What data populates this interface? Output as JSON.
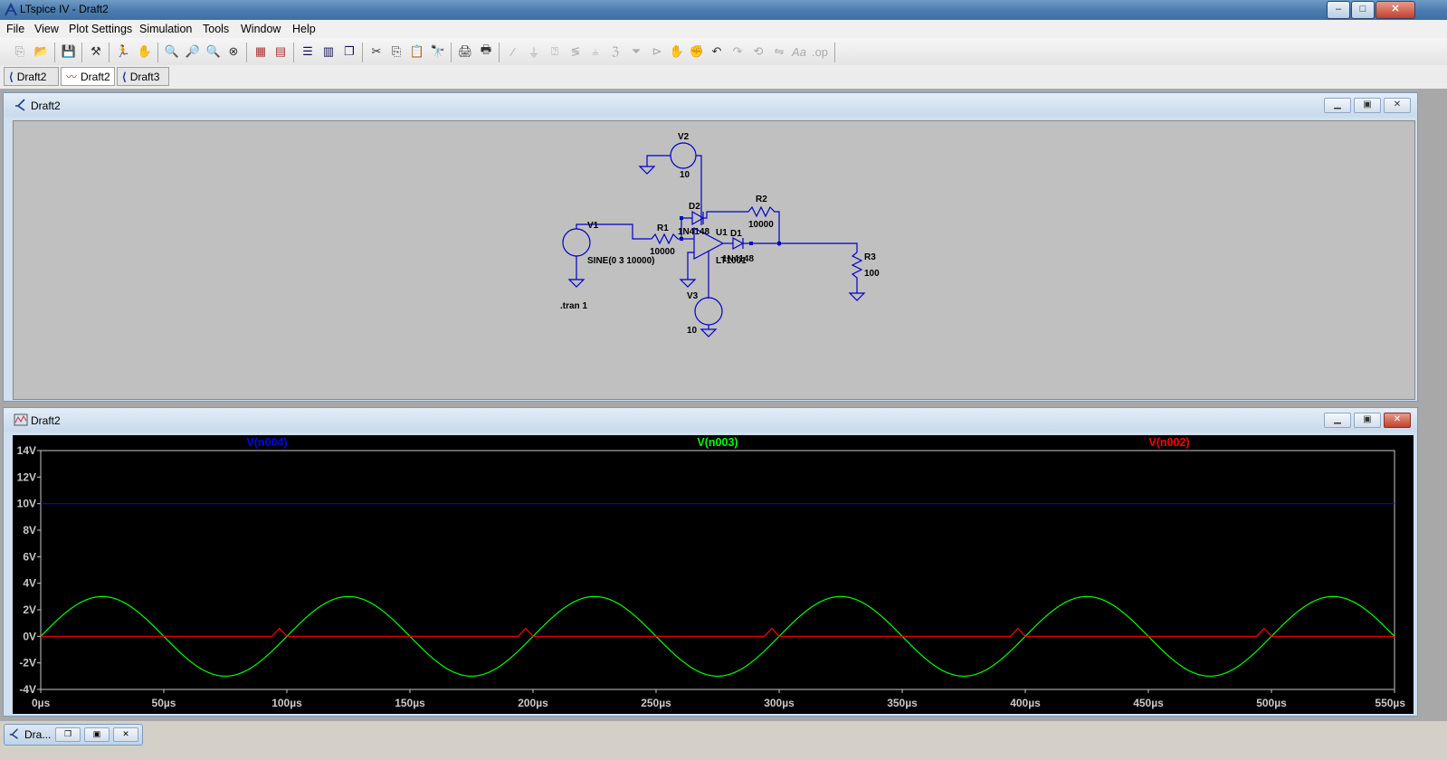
{
  "window": {
    "title": "LTspice IV - Draft2",
    "controls": [
      "–",
      "□",
      "✕"
    ]
  },
  "menu": [
    "File",
    "View",
    "Plot Settings",
    "Simulation",
    "Tools",
    "Window",
    "Help"
  ],
  "tabs": [
    {
      "label": "Draft2",
      "icon": "schematic-icon"
    },
    {
      "label": "Draft2",
      "icon": "waveform-icon"
    },
    {
      "label": "Draft3",
      "icon": "schematic-icon"
    }
  ],
  "schematic_window": {
    "title": "Draft2",
    "components": {
      "v1": {
        "name": "V1",
        "value": "SINE(0 3 10000)"
      },
      "v2": {
        "name": "V2",
        "value": "10"
      },
      "v3": {
        "name": "V3",
        "value": "10"
      },
      "r1": {
        "name": "R1",
        "value": "10000"
      },
      "r2": {
        "name": "R2",
        "value": "10000"
      },
      "r3": {
        "name": "R3",
        "value": "100"
      },
      "d1": {
        "name": "D1",
        "value": "1N4148"
      },
      "d2": {
        "name": "D2",
        "value": "1N4148"
      },
      "u1": {
        "name": "U1",
        "value": "LT1001"
      }
    },
    "directive": ".tran 1"
  },
  "plot_window": {
    "title": "Draft2"
  },
  "chart_data": {
    "type": "line",
    "title": "",
    "xlabel": "",
    "ylabel": "",
    "xlim": [
      0,
      550
    ],
    "ylim": [
      -4,
      14
    ],
    "x_ticks": [
      "0µs",
      "50µs",
      "100µs",
      "150µs",
      "200µs",
      "250µs",
      "300µs",
      "350µs",
      "400µs",
      "450µs",
      "500µs",
      "550µs"
    ],
    "y_ticks": [
      "14V",
      "12V",
      "10V",
      "8V",
      "6V",
      "4V",
      "2V",
      "0V",
      "-2V",
      "-4V"
    ],
    "legend_placement": "top",
    "background": "#000000",
    "series": [
      {
        "name": "V(n004)",
        "color": "#0000ff",
        "x": [
          0,
          550
        ],
        "values": [
          10,
          10
        ]
      },
      {
        "name": "V(n003)",
        "color": "#00ff00",
        "x": [
          0,
          25,
          50,
          75,
          100,
          125,
          150,
          175,
          200,
          225,
          250,
          275,
          300,
          325,
          350,
          375,
          400,
          425,
          450,
          475,
          500,
          525,
          550
        ],
        "values": [
          0,
          3,
          0,
          -3,
          0,
          3,
          0,
          -3,
          0,
          3,
          0,
          -3,
          0,
          3,
          0,
          -3,
          0,
          3,
          0,
          -3,
          0,
          3,
          0
        ]
      },
      {
        "name": "V(n002)",
        "color": "#ff0000",
        "x": [
          0,
          94,
          97,
          100,
          194,
          197,
          200,
          294,
          297,
          300,
          394,
          397,
          400,
          494,
          497,
          500,
          550
        ],
        "values": [
          0,
          0,
          0.6,
          0,
          0,
          0.6,
          0,
          0,
          0.6,
          0,
          0,
          0.6,
          0,
          0,
          0.6,
          0,
          0
        ]
      }
    ]
  },
  "taskbar": {
    "minimized_label": "Dra..."
  }
}
